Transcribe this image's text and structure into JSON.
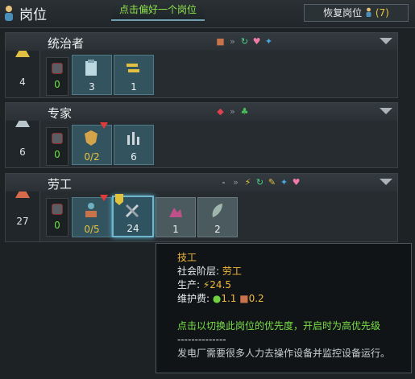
{
  "header": {
    "title": "岗位",
    "hint": "点击偏好一个岗位",
    "restore_label": "恢复岗位",
    "restore_count": "(7)"
  },
  "strata": [
    {
      "name": "统治者",
      "pop": "4",
      "unemployed": "0",
      "flags_prefix": "",
      "jobs": [
        {
          "icon": "clipboard-icon",
          "value": "3"
        },
        {
          "icon": "trade-icon",
          "value": "1"
        }
      ]
    },
    {
      "name": "专家",
      "pop": "6",
      "unemployed": "0",
      "flags_prefix": "",
      "jobs": [
        {
          "icon": "badge-icon",
          "value": "0/2"
        },
        {
          "icon": "researcher-icon",
          "value": "6"
        }
      ]
    },
    {
      "name": "劳工",
      "pop": "27",
      "unemployed": "0",
      "flags_prefix": "-",
      "jobs": [
        {
          "icon": "worker-icon",
          "value": "0/5"
        },
        {
          "icon": "technician-icon",
          "value": "24"
        },
        {
          "icon": "miner-icon",
          "value": "1"
        },
        {
          "icon": "farmer-icon",
          "value": "2"
        }
      ]
    }
  ],
  "tooltip": {
    "title": "技工",
    "stratum_label": "社会阶层: ",
    "stratum_value": "劳工",
    "produce_label": "生产: ",
    "produce_value": "24.5",
    "upkeep_label": "维护费: ",
    "upkeep_food": "1.1",
    "upkeep_goods": "0.2",
    "priority_hint": "点击以切换此岗位的优先度，开启时为高优先级",
    "separator": "--------------",
    "description": "发电厂需要很多人力去操作设备并监控设备运行。"
  }
}
